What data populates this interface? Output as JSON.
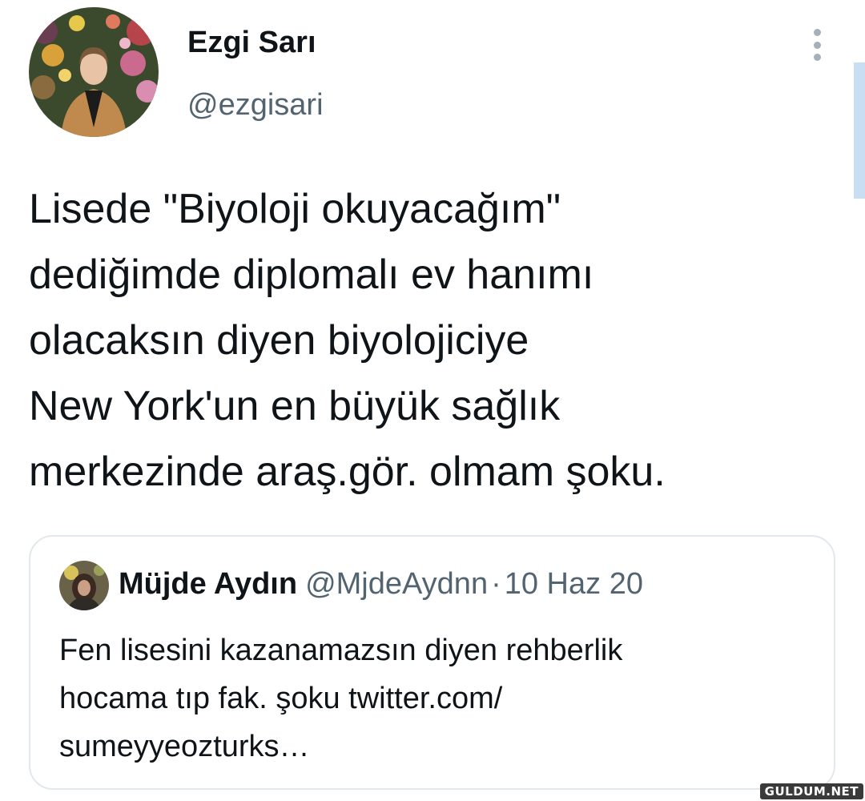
{
  "tweet": {
    "author": {
      "display_name": "Ezgi Sarı",
      "handle": "@ezgisari",
      "avatar": "profile-photo"
    },
    "more_icon": "more-vertical-icon",
    "text_lines": [
      "Lisede \"Biyoloji okuyacağım\"",
      "dediğimde diplomalı ev hanımı",
      "olacaksın diyen biyolojiciye",
      "New York'un en büyük sağlık",
      "merkezinde araş.gör. olmam şoku."
    ]
  },
  "quoted_tweet": {
    "display_name": "Müjde Aydın",
    "handle": "@MjdeAydnn",
    "separator": "·",
    "date": "10 Haz 20",
    "text_lines": [
      "Fen lisesini kazanamazsın diyen rehberlik",
      "hocama tıp fak. şoku twitter.com/",
      "sumeyyeozturks…"
    ]
  },
  "watermark": "GULDUM.NET",
  "colors": {
    "text": "#0f1419",
    "secondary": "#536471",
    "border": "#e3e8ec",
    "scrollbar": "#c9def2"
  }
}
